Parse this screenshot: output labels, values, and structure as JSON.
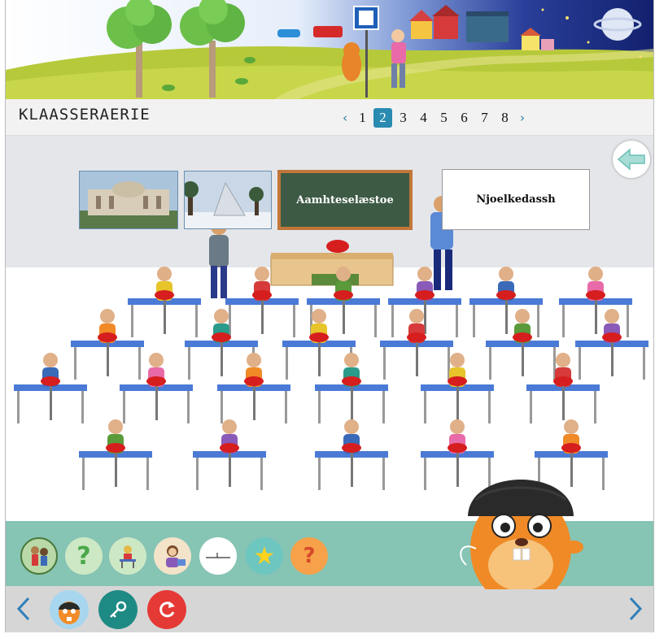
{
  "header": {
    "title": "KLAASSERAERIE"
  },
  "pager": {
    "prev_icon": "chevron-left-icon",
    "next_icon": "chevron-right-icon",
    "pages": [
      "1",
      "2",
      "3",
      "4",
      "5",
      "6",
      "7",
      "8"
    ],
    "active_page": "2"
  },
  "scene": {
    "thumbnails": [
      {
        "name": "parliament-building-photo"
      },
      {
        "name": "sami-parliament-photo"
      }
    ],
    "board_label": "Aamhteselæstoe",
    "card_label": "Njoelkedassh",
    "back_icon": "arrow-left-icon"
  },
  "toolbar": {
    "tools": [
      {
        "name": "pupils-tool",
        "icon": "pupils-icon",
        "color": "#b9d9a8"
      },
      {
        "name": "question-tool",
        "icon": "question-mark-icon",
        "color": "#cde8c4"
      },
      {
        "name": "desk-tool",
        "icon": "student-desk-icon",
        "color": "#cde8c4"
      },
      {
        "name": "teacher-tool",
        "icon": "teacher-icon",
        "color": "#f3e3c9"
      },
      {
        "name": "blank-tool",
        "icon": "line-icon",
        "color": "#ffffff"
      },
      {
        "name": "star-tool",
        "icon": "star-icon",
        "color": "#6ec6c0"
      },
      {
        "name": "quiz-tool",
        "icon": "question-orange-icon",
        "color": "#f7a24a"
      }
    ]
  },
  "bottomnav": {
    "prev_icon": "chevron-left-icon",
    "next_icon": "chevron-right-icon",
    "mascot_icon": "mascot-beaver-icon",
    "key_icon": "key-icon",
    "reload_icon": "reload-icon"
  },
  "colors": {
    "accent": "#2a8bb0",
    "toolbar": "#86c4b4",
    "nav_bg": "#d6d6d6",
    "reload": "#e53935",
    "key": "#1e8a84",
    "board": "#3d5a44"
  }
}
